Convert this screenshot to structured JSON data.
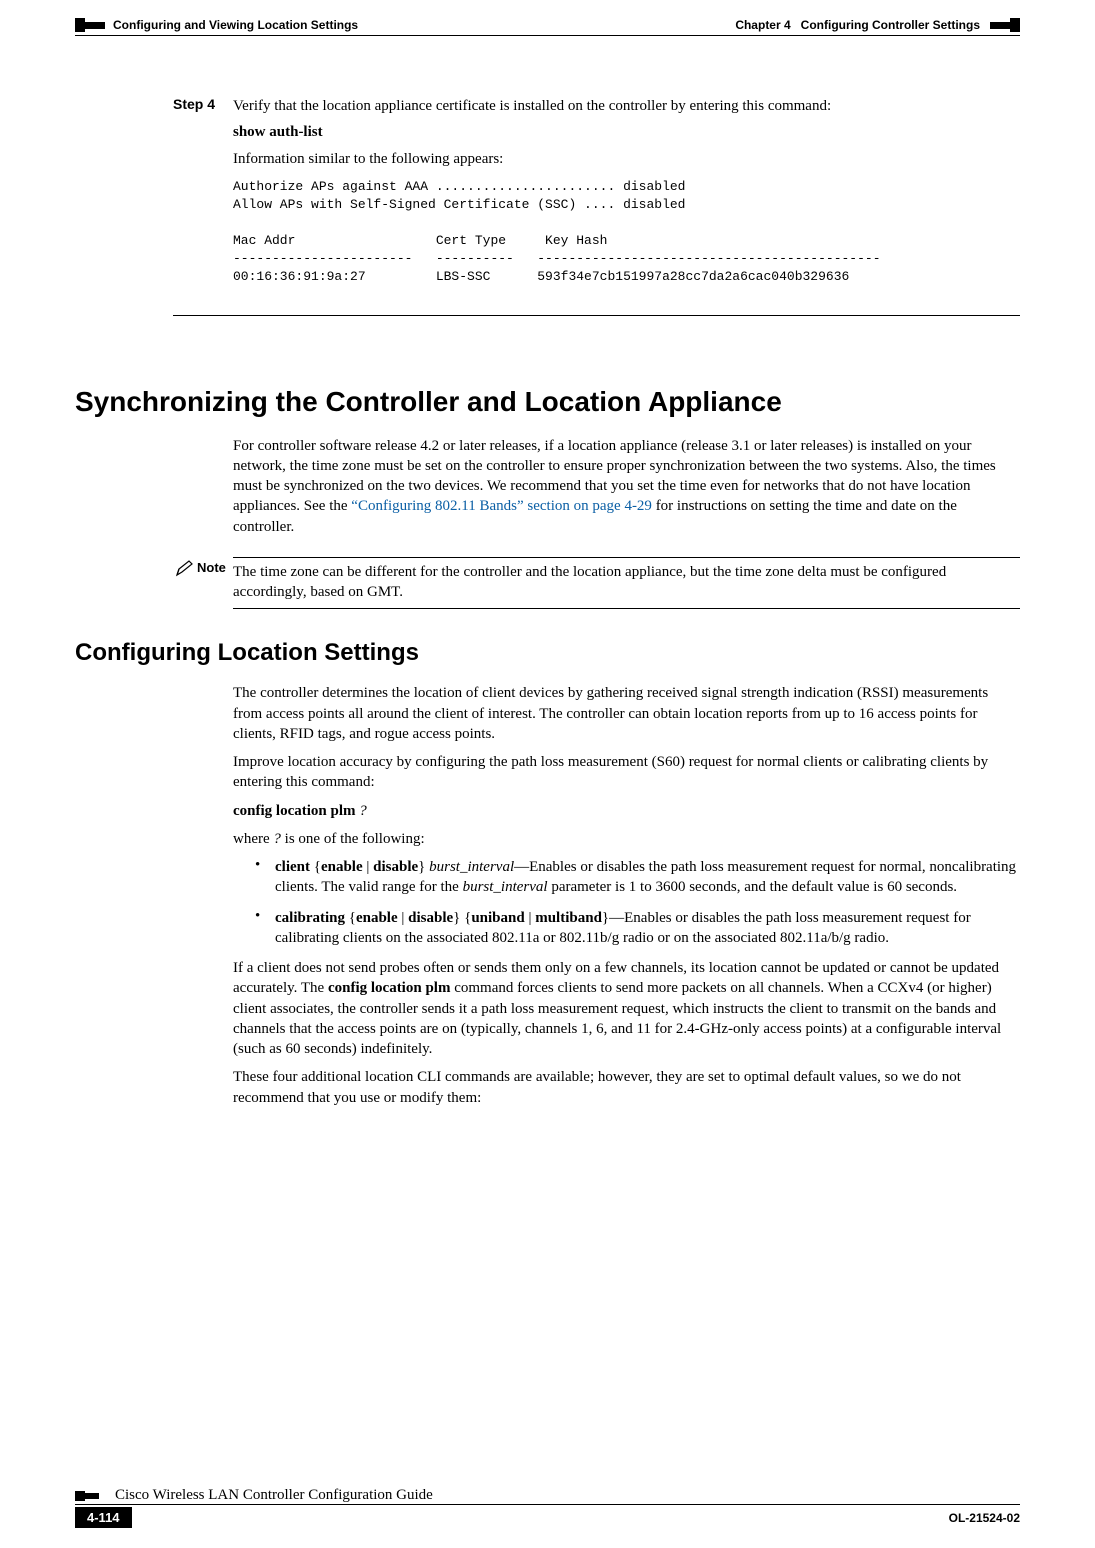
{
  "header": {
    "chapter_label": "Chapter 4",
    "chapter_title": "Configuring Controller Settings",
    "section_title": "Configuring and Viewing Location Settings"
  },
  "step4": {
    "label": "Step 4",
    "text": "Verify that the location appliance certificate is installed on the controller by entering this command:",
    "command": "show auth-list",
    "info_text": "Information similar to the following appears:",
    "output": "Authorize APs against AAA ....................... disabled\nAllow APs with Self-Signed Certificate (SSC) .... disabled\n\nMac Addr                  Cert Type     Key Hash\n-----------------------   ----------   --------------------------------------------\n00:16:36:91:9a:27         LBS-SSC      593f34e7cb151997a28cc7da2a6cac040b329636"
  },
  "sync": {
    "heading": "Synchronizing the Controller and Location Appliance",
    "para_before_link": "For controller software release 4.2 or later releases, if a location appliance (release 3.1 or later releases) is installed on your network, the time zone must be set on the controller to ensure proper synchronization between the two systems. Also, the times must be synchronized on the two devices. We recommend that you set the time even for networks that do not have location appliances. See the ",
    "link_text": "“Configuring 802.11 Bands” section on page 4-29",
    "para_after_link": " for instructions on setting the time and date on the controller."
  },
  "note": {
    "label": "Note",
    "text": "The time zone can be different for the controller and the location appliance, but the time zone delta must be configured accordingly, based on GMT."
  },
  "locset": {
    "heading": "Configuring Location Settings",
    "para1": "The controller determines the location of client devices by gathering received signal strength indication (RSSI) measurements from access points all around the client of interest. The controller can obtain location reports from up to 16 access points for clients, RFID tags, and rogue access points.",
    "para2": "Improve location accuracy by configuring the path loss measurement (S60) request for normal clients or calibrating clients by entering this command:",
    "command_prefix": "config location plm ",
    "command_arg": "?",
    "where_prefix": "where ",
    "where_arg": "?",
    "where_suffix": " is one of the following:",
    "bullets": [
      {
        "b1": "client",
        "p1": " {",
        "b2": "enable",
        "p2": " | ",
        "b3": "disable",
        "p3": "} ",
        "i1": "burst_interval",
        "rest1": "—Enables or disables the path loss measurement request for normal, noncalibrating clients. The valid range for the ",
        "i2": "burst_interval",
        "rest2": " parameter is 1 to 3600 seconds, and the default value is 60 seconds."
      },
      {
        "b1": "calibrating",
        "p1": " {",
        "b2": "enable",
        "p2": " | ",
        "b3": "disable",
        "p3": "} {",
        "b4": "uniband",
        "p4": " | ",
        "b5": "multiband",
        "p5": "}—Enables or disables the path loss measurement request for calibrating clients on the associated 802.11a or 802.11b/g radio or on the associated 802.11a/b/g radio."
      }
    ],
    "para3_a": "If a client does not send probes often or sends them only on a few channels, its location cannot be updated or cannot be updated accurately. The ",
    "para3_b": "config location plm",
    "para3_c": " command forces clients to send more packets on all channels. When a CCXv4 (or higher) client associates, the controller sends it a path loss measurement request, which instructs the client to transmit on the bands and channels that the access points are on (typically, channels 1, 6, and 11 for 2.4-GHz-only access points) at a configurable interval (such as 60 seconds) indefinitely.",
    "para4": "These four additional location CLI commands are available; however, they are set to optimal default values, so we do not recommend that you use or modify them:"
  },
  "footer": {
    "doc_title": "Cisco Wireless LAN Controller Configuration Guide",
    "page_num": "4-114",
    "doc_id": "OL-21524-02"
  }
}
